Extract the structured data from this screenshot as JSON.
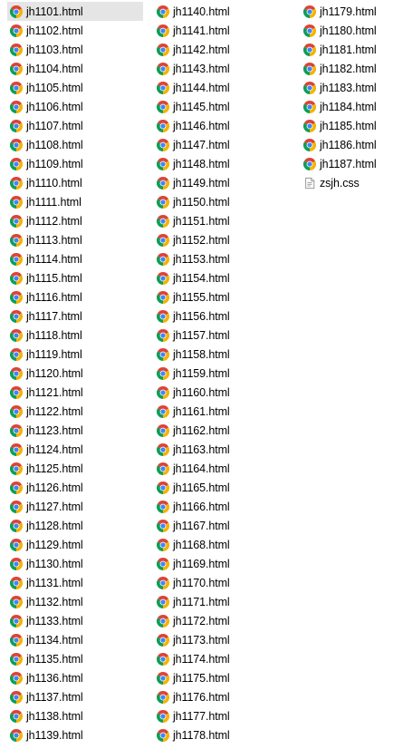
{
  "files": {
    "columns": [
      [
        {
          "name": "jh1101.html",
          "icon": "chrome-html-icon",
          "selected": true
        },
        {
          "name": "jh1102.html",
          "icon": "chrome-html-icon"
        },
        {
          "name": "jh1103.html",
          "icon": "chrome-html-icon"
        },
        {
          "name": "jh1104.html",
          "icon": "chrome-html-icon"
        },
        {
          "name": "jh1105.html",
          "icon": "chrome-html-icon"
        },
        {
          "name": "jh1106.html",
          "icon": "chrome-html-icon"
        },
        {
          "name": "jh1107.html",
          "icon": "chrome-html-icon"
        },
        {
          "name": "jh1108.html",
          "icon": "chrome-html-icon"
        },
        {
          "name": "jh1109.html",
          "icon": "chrome-html-icon"
        },
        {
          "name": "jh1110.html",
          "icon": "chrome-html-icon"
        },
        {
          "name": "jh1111.html",
          "icon": "chrome-html-icon"
        },
        {
          "name": "jh1112.html",
          "icon": "chrome-html-icon"
        },
        {
          "name": "jh1113.html",
          "icon": "chrome-html-icon"
        },
        {
          "name": "jh1114.html",
          "icon": "chrome-html-icon"
        },
        {
          "name": "jh1115.html",
          "icon": "chrome-html-icon"
        },
        {
          "name": "jh1116.html",
          "icon": "chrome-html-icon"
        },
        {
          "name": "jh1117.html",
          "icon": "chrome-html-icon"
        },
        {
          "name": "jh1118.html",
          "icon": "chrome-html-icon"
        },
        {
          "name": "jh1119.html",
          "icon": "chrome-html-icon"
        },
        {
          "name": "jh1120.html",
          "icon": "chrome-html-icon"
        },
        {
          "name": "jh1121.html",
          "icon": "chrome-html-icon"
        },
        {
          "name": "jh1122.html",
          "icon": "chrome-html-icon"
        },
        {
          "name": "jh1123.html",
          "icon": "chrome-html-icon"
        },
        {
          "name": "jh1124.html",
          "icon": "chrome-html-icon"
        },
        {
          "name": "jh1125.html",
          "icon": "chrome-html-icon"
        },
        {
          "name": "jh1126.html",
          "icon": "chrome-html-icon"
        },
        {
          "name": "jh1127.html",
          "icon": "chrome-html-icon"
        },
        {
          "name": "jh1128.html",
          "icon": "chrome-html-icon"
        },
        {
          "name": "jh1129.html",
          "icon": "chrome-html-icon"
        },
        {
          "name": "jh1130.html",
          "icon": "chrome-html-icon"
        },
        {
          "name": "jh1131.html",
          "icon": "chrome-html-icon"
        },
        {
          "name": "jh1132.html",
          "icon": "chrome-html-icon"
        },
        {
          "name": "jh1133.html",
          "icon": "chrome-html-icon"
        },
        {
          "name": "jh1134.html",
          "icon": "chrome-html-icon"
        },
        {
          "name": "jh1135.html",
          "icon": "chrome-html-icon"
        },
        {
          "name": "jh1136.html",
          "icon": "chrome-html-icon"
        },
        {
          "name": "jh1137.html",
          "icon": "chrome-html-icon"
        },
        {
          "name": "jh1138.html",
          "icon": "chrome-html-icon"
        },
        {
          "name": "jh1139.html",
          "icon": "chrome-html-icon"
        }
      ],
      [
        {
          "name": "jh1140.html",
          "icon": "chrome-html-icon"
        },
        {
          "name": "jh1141.html",
          "icon": "chrome-html-icon"
        },
        {
          "name": "jh1142.html",
          "icon": "chrome-html-icon"
        },
        {
          "name": "jh1143.html",
          "icon": "chrome-html-icon"
        },
        {
          "name": "jh1144.html",
          "icon": "chrome-html-icon"
        },
        {
          "name": "jh1145.html",
          "icon": "chrome-html-icon"
        },
        {
          "name": "jh1146.html",
          "icon": "chrome-html-icon"
        },
        {
          "name": "jh1147.html",
          "icon": "chrome-html-icon"
        },
        {
          "name": "jh1148.html",
          "icon": "chrome-html-icon"
        },
        {
          "name": "jh1149.html",
          "icon": "chrome-html-icon"
        },
        {
          "name": "jh1150.html",
          "icon": "chrome-html-icon"
        },
        {
          "name": "jh1151.html",
          "icon": "chrome-html-icon"
        },
        {
          "name": "jh1152.html",
          "icon": "chrome-html-icon"
        },
        {
          "name": "jh1153.html",
          "icon": "chrome-html-icon"
        },
        {
          "name": "jh1154.html",
          "icon": "chrome-html-icon"
        },
        {
          "name": "jh1155.html",
          "icon": "chrome-html-icon"
        },
        {
          "name": "jh1156.html",
          "icon": "chrome-html-icon"
        },
        {
          "name": "jh1157.html",
          "icon": "chrome-html-icon"
        },
        {
          "name": "jh1158.html",
          "icon": "chrome-html-icon"
        },
        {
          "name": "jh1159.html",
          "icon": "chrome-html-icon"
        },
        {
          "name": "jh1160.html",
          "icon": "chrome-html-icon"
        },
        {
          "name": "jh1161.html",
          "icon": "chrome-html-icon"
        },
        {
          "name": "jh1162.html",
          "icon": "chrome-html-icon"
        },
        {
          "name": "jh1163.html",
          "icon": "chrome-html-icon"
        },
        {
          "name": "jh1164.html",
          "icon": "chrome-html-icon"
        },
        {
          "name": "jh1165.html",
          "icon": "chrome-html-icon"
        },
        {
          "name": "jh1166.html",
          "icon": "chrome-html-icon"
        },
        {
          "name": "jh1167.html",
          "icon": "chrome-html-icon"
        },
        {
          "name": "jh1168.html",
          "icon": "chrome-html-icon"
        },
        {
          "name": "jh1169.html",
          "icon": "chrome-html-icon"
        },
        {
          "name": "jh1170.html",
          "icon": "chrome-html-icon"
        },
        {
          "name": "jh1171.html",
          "icon": "chrome-html-icon"
        },
        {
          "name": "jh1172.html",
          "icon": "chrome-html-icon"
        },
        {
          "name": "jh1173.html",
          "icon": "chrome-html-icon"
        },
        {
          "name": "jh1174.html",
          "icon": "chrome-html-icon"
        },
        {
          "name": "jh1175.html",
          "icon": "chrome-html-icon"
        },
        {
          "name": "jh1176.html",
          "icon": "chrome-html-icon"
        },
        {
          "name": "jh1177.html",
          "icon": "chrome-html-icon"
        },
        {
          "name": "jh1178.html",
          "icon": "chrome-html-icon"
        }
      ],
      [
        {
          "name": "jh1179.html",
          "icon": "chrome-html-icon"
        },
        {
          "name": "jh1180.html",
          "icon": "chrome-html-icon"
        },
        {
          "name": "jh1181.html",
          "icon": "chrome-html-icon"
        },
        {
          "name": "jh1182.html",
          "icon": "chrome-html-icon"
        },
        {
          "name": "jh1183.html",
          "icon": "chrome-html-icon"
        },
        {
          "name": "jh1184.html",
          "icon": "chrome-html-icon"
        },
        {
          "name": "jh1185.html",
          "icon": "chrome-html-icon"
        },
        {
          "name": "jh1186.html",
          "icon": "chrome-html-icon"
        },
        {
          "name": "jh1187.html",
          "icon": "chrome-html-icon"
        },
        {
          "name": "zsjh.css",
          "icon": "css-file-icon"
        }
      ]
    ]
  },
  "colors": {
    "selection": "#e5e5e5",
    "chrome_red": "#db4437",
    "chrome_green": "#0f9d58",
    "chrome_yellow": "#f4b400",
    "chrome_blue": "#4285f4"
  }
}
